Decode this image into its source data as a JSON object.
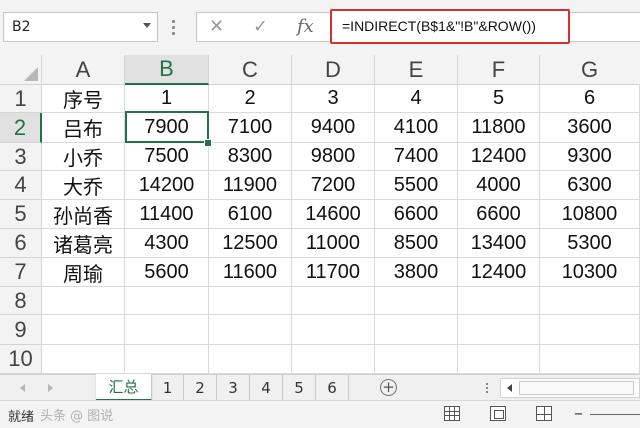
{
  "formula_bar": {
    "name_box": "B2",
    "cancel_icon": "✕",
    "enter_icon": "✓",
    "fx_label": "fx",
    "formula": "=INDIRECT(B$1&\"!B\"&ROW())"
  },
  "sheet": {
    "column_headers": [
      "A",
      "B",
      "C",
      "D",
      "E",
      "F",
      "G"
    ],
    "row_headers": [
      "1",
      "2",
      "3",
      "4",
      "5",
      "6",
      "7",
      "8",
      "9",
      "10"
    ],
    "selected_cell": "B2",
    "rows": [
      [
        "序号",
        "1",
        "2",
        "3",
        "4",
        "5",
        "6"
      ],
      [
        "吕布",
        "7900",
        "7100",
        "9400",
        "4100",
        "11800",
        "3600"
      ],
      [
        "小乔",
        "7500",
        "8300",
        "9800",
        "7400",
        "12400",
        "9300"
      ],
      [
        "大乔",
        "14200",
        "11900",
        "7200",
        "5500",
        "4000",
        "6300"
      ],
      [
        "孙尚香",
        "11400",
        "6100",
        "14600",
        "6600",
        "6600",
        "10800"
      ],
      [
        "诸葛亮",
        "4300",
        "12500",
        "11000",
        "8500",
        "13400",
        "5300"
      ],
      [
        "周瑜",
        "5600",
        "11600",
        "11700",
        "3800",
        "12400",
        "10300"
      ],
      [
        "",
        "",
        "",
        "",
        "",
        "",
        ""
      ],
      [
        "",
        "",
        "",
        "",
        "",
        "",
        ""
      ],
      [
        "",
        "",
        "",
        "",
        "",
        "",
        ""
      ]
    ]
  },
  "tabs": {
    "items": [
      "汇总",
      "1",
      "2",
      "3",
      "4",
      "5",
      "6"
    ],
    "active": "汇总",
    "add_icon": "+"
  },
  "status": {
    "ready": "就绪",
    "watermark": "头条 @ 图说"
  },
  "colors": {
    "accent": "#217346",
    "formula_highlight": "#d0332f"
  }
}
